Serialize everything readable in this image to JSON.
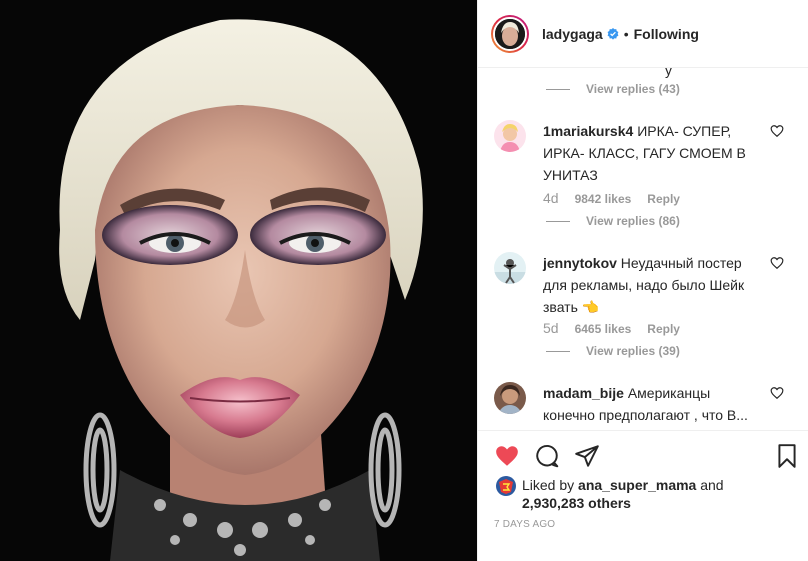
{
  "post": {
    "image_alt": "Portrait photo",
    "header": {
      "username": "ladygaga",
      "separator": "•",
      "follow_status": "Following",
      "verified_icon": "verified-badge-icon",
      "verified_color": "#3897f0"
    },
    "comments_panel": {
      "top_fragment": "у",
      "top_view_replies": "View replies (43)",
      "comments": [
        {
          "username": "1mariakursk4",
          "text": "ИРКА- СУПЕР, ИРКА- КЛАСС, ГАГУ СМОЕМ В УНИТАЗ",
          "age": "4d",
          "likes": "9842 likes",
          "reply": "Reply",
          "view_replies": "View replies (86)"
        },
        {
          "username": "jennytokov",
          "text": "Неудачный постер для рекламы, надо было Шейк звать 👈",
          "age": "5d",
          "likes": "6465 likes",
          "reply": "Reply",
          "view_replies": "View replies (39)"
        },
        {
          "username": "madam_bije",
          "text": "Американцы конечно предполагают , что В... 😂😂"
        }
      ]
    },
    "actions": {
      "like_color": "#ed4956",
      "icons": [
        "heart-filled-icon",
        "comment-icon",
        "share-icon",
        "bookmark-icon"
      ]
    },
    "likes": {
      "prefix": "Liked by",
      "user": "ana_super_mama",
      "joiner": "and",
      "count": "2,930,283 others"
    },
    "timestamp": "7 DAYS AGO"
  }
}
